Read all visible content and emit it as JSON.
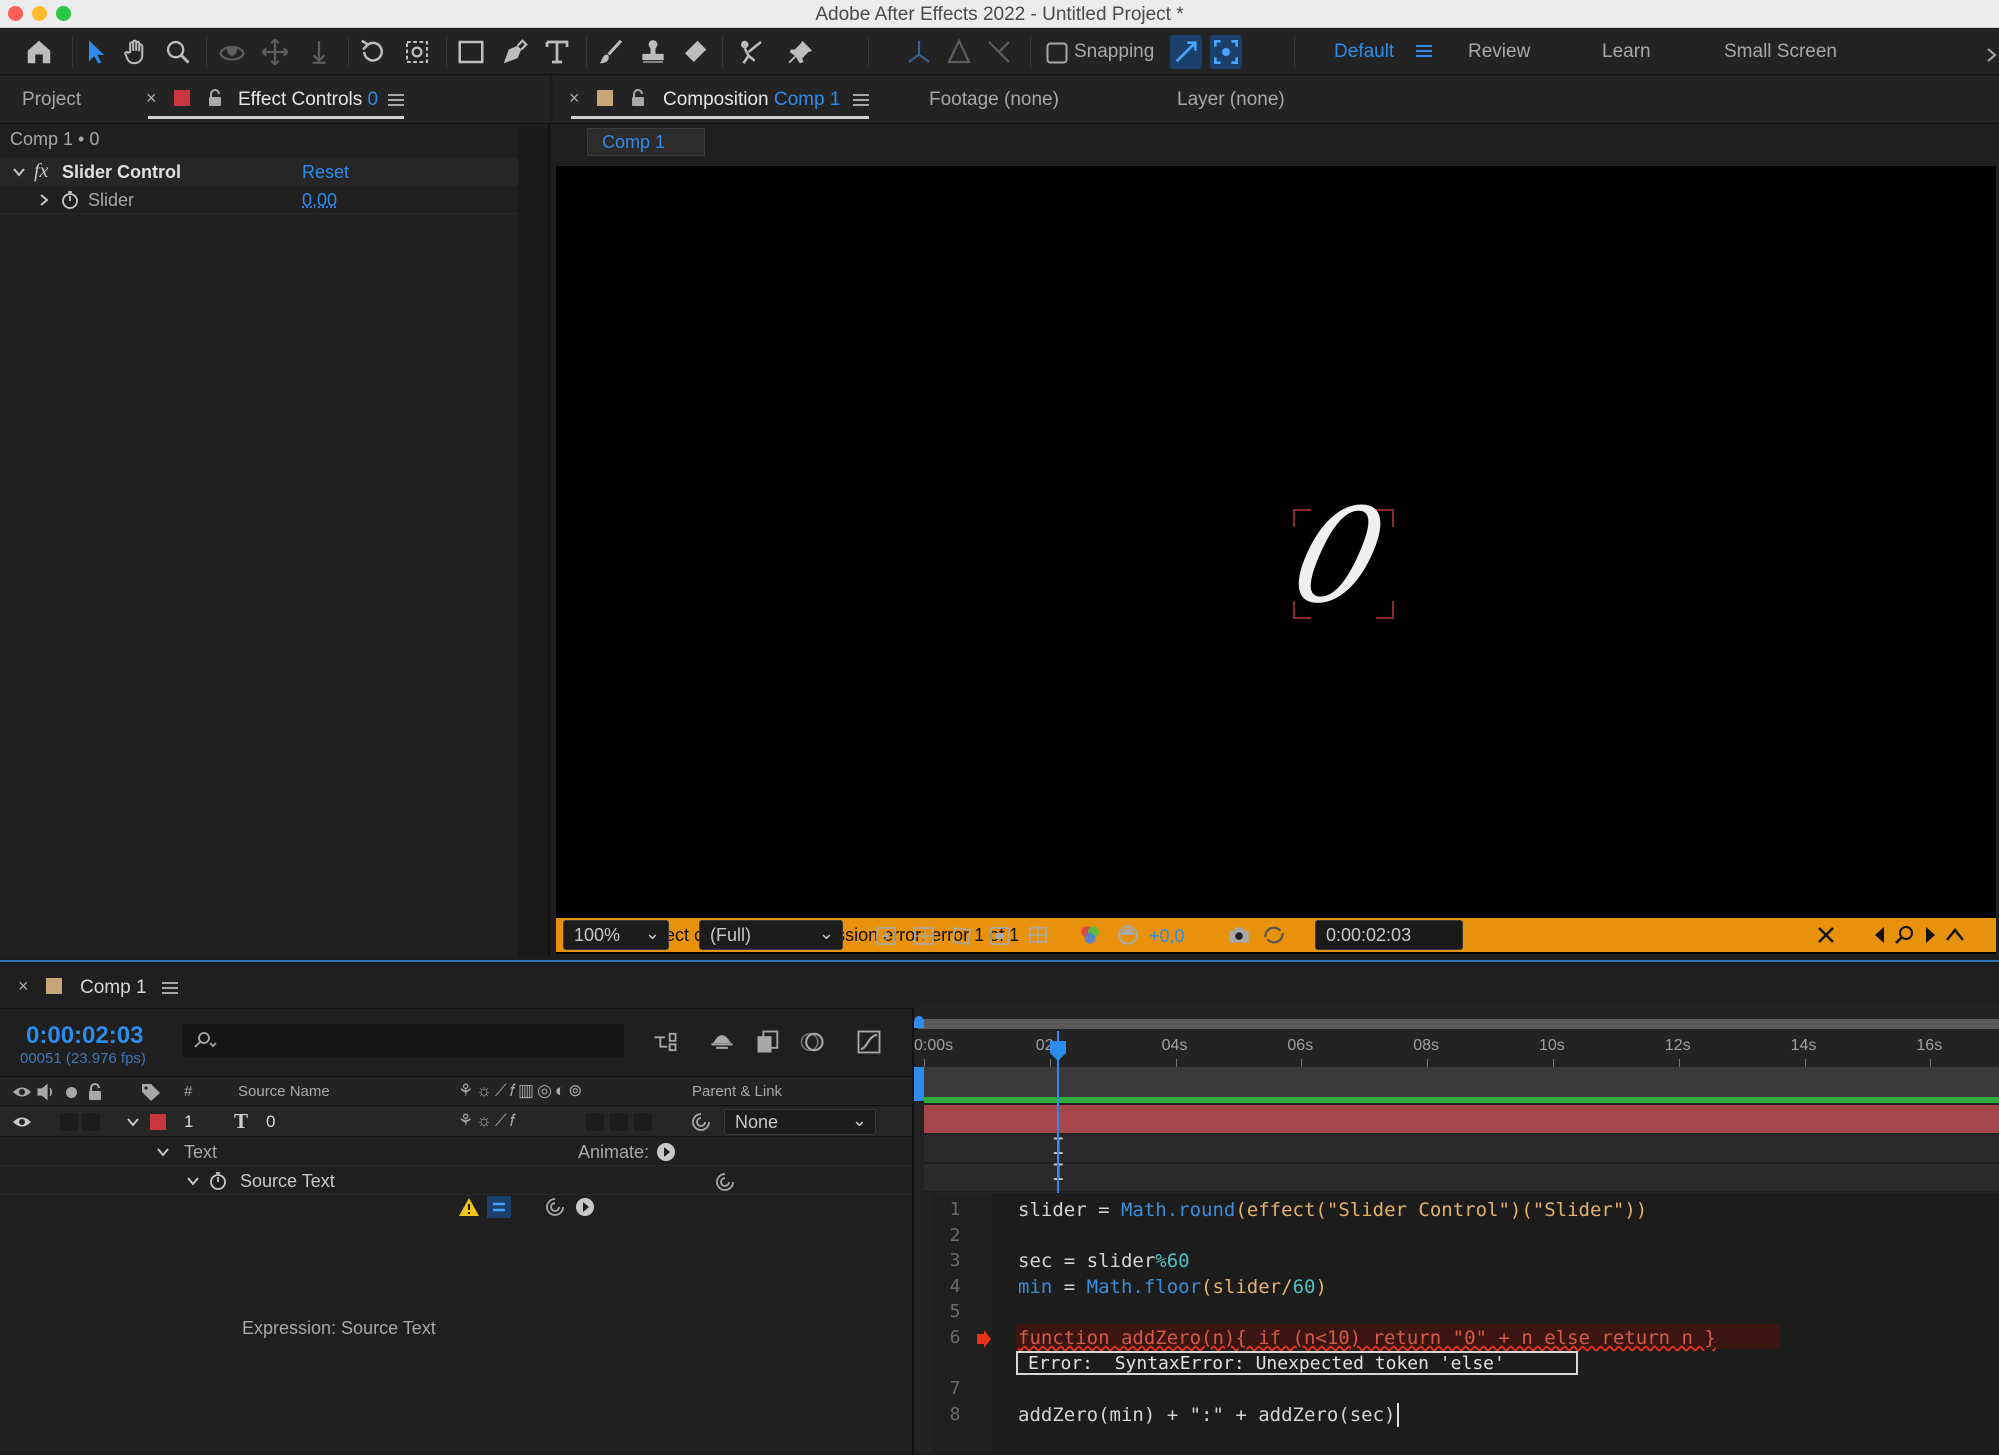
{
  "window": {
    "title": "Adobe After Effects 2022 - Untitled Project *"
  },
  "toolbar": {
    "tools": [
      "home-icon",
      "selection-tool-icon",
      "hand-tool-icon",
      "zoom-tool-icon",
      "orbit-camera-icon",
      "pan-camera-icon",
      "dolly-camera-icon",
      "rotation-tool-icon",
      "pan-behind-icon",
      "rectangle-tool-icon",
      "pen-tool-icon",
      "type-tool-icon",
      "brush-tool-icon",
      "clone-stamp-icon",
      "eraser-icon",
      "roto-brush-icon",
      "puppet-pin-icon"
    ],
    "snapping_label": "Snapping",
    "workspaces": {
      "default": "Default",
      "review": "Review",
      "learn": "Learn",
      "small_screen": "Small Screen"
    }
  },
  "left_panel": {
    "tab_project": "Project",
    "tab_effect_controls": "Effect Controls",
    "tab_effect_controls_layer": "0",
    "breadcrumb": "Comp 1 • 0",
    "effect": {
      "name": "Slider Control",
      "reset_label": "Reset",
      "property_name": "Slider",
      "property_value": "0,00"
    }
  },
  "viewer": {
    "tab_composition_prefix": "Composition",
    "tab_composition_name": "Comp 1",
    "tab_footage": "Footage (none)",
    "tab_layer": "Layer (none)",
    "comp_tab": "Comp 1",
    "canvas_text": "0",
    "error_message": "This project contains an expression error: error 1 of 1",
    "zoom": "100%",
    "resolution": "(Full)",
    "exposure": "+0,0",
    "timecode": "0:00:02:03"
  },
  "timeline": {
    "tab_label": "Comp 1",
    "current_time": "0:00:02:03",
    "frame_info": "00051 (23.976 fps)",
    "search_placeholder": "",
    "columns": {
      "number": "#",
      "source_name": "Source Name",
      "parent_link": "Parent & Link"
    },
    "layer": {
      "index": "1",
      "name": "0",
      "parent": "None"
    },
    "text_group": "Text",
    "animate_label": "Animate:",
    "source_text": "Source Text",
    "expression_label": "Expression: Source Text",
    "ruler_ticks": [
      "0:00s",
      "02s",
      "04s",
      "06s",
      "08s",
      "10s",
      "12s",
      "14s",
      "16s"
    ],
    "playhead_seconds": 2.125
  },
  "expression": {
    "line_numbers": [
      "1",
      "2",
      "3",
      "4",
      "5",
      "6",
      "7",
      "8"
    ],
    "line1": {
      "var": "slider",
      "op": " = ",
      "fn": "Math.round",
      "rest_a": "(effect(",
      "str1": "\"Slider Control\"",
      "rest_b": ")(",
      "str2": "\"Slider\"",
      "rest_c": "))"
    },
    "line3": {
      "var": "sec",
      "op": " = slider",
      "pct": "%",
      "num": "60"
    },
    "line4": {
      "var": "min",
      "op": " = ",
      "fn": "Math.floor",
      "rest": "(slider/",
      "num": "60",
      "close": ")"
    },
    "line6": "function addZero(n){ if (n<10) return \"0\" + n else return n }",
    "error_text": "Error:  SyntaxError: Unexpected token 'else'",
    "line8": "addZero(min) + \":\" + addZero(sec)"
  },
  "colors": {
    "accent": "#2d8ceb",
    "warning": "#e8920b",
    "layer_label": "#c8373d",
    "layer_bar": "#a6454b",
    "work_area": "#2fae3d"
  }
}
